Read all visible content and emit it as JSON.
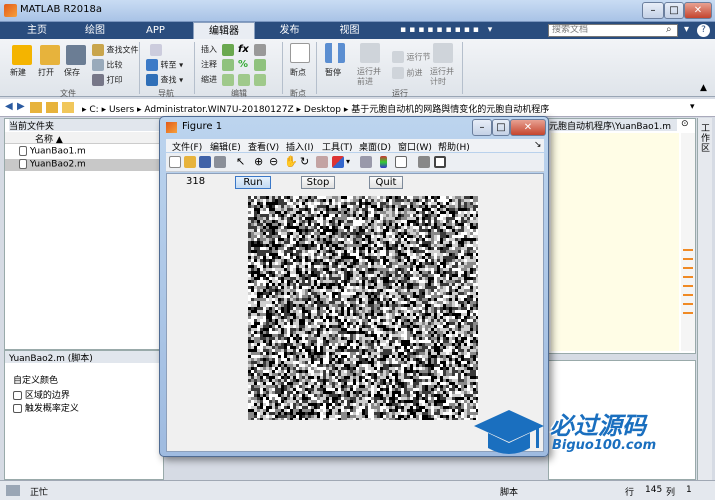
{
  "window": {
    "title": "MATLAB R2018a"
  },
  "tabs": [
    {
      "label": "主页"
    },
    {
      "label": "绘图"
    },
    {
      "label": "APP"
    },
    {
      "label": "编辑器"
    },
    {
      "label": "发布"
    },
    {
      "label": "视图"
    }
  ],
  "search": {
    "placeholder": "搜索文档"
  },
  "ribbon": {
    "new": "新建",
    "open": "打开",
    "save": "保存",
    "find_files": "查找文件",
    "compare": "比较",
    "print": "打印",
    "insert": "插入",
    "comment": "注释",
    "indent": "缩进",
    "goto": "转至",
    "find": "查找",
    "breakpoints": "断点",
    "pause": "暂停",
    "run_advance": "运行并\n前进",
    "run_section": "运行节",
    "advance": "前进",
    "run_time": "运行并\n计时",
    "groups": {
      "file": "文件",
      "nav": "导航",
      "edit": "编辑",
      "bp": "断点",
      "run": "运行"
    }
  },
  "path": {
    "parts": [
      "C:",
      "Users",
      "Administrator.WIN7U-20180127Z",
      "Desktop",
      "基于元胞自动机的网路舆情变化的元胞自动机程序"
    ]
  },
  "current_folder": {
    "title": "当前文件夹",
    "col_name": "名称",
    "files": [
      {
        "name": "YuanBao1.m"
      },
      {
        "name": "YuanBao2.m"
      }
    ]
  },
  "details": {
    "title": "YuanBao2.m  (脚本)",
    "items": [
      "自定义颜色",
      "区域的边界",
      "触发概率定义"
    ]
  },
  "editor": {
    "path_tail": "元胞自动机程序\\YuanBao1.m"
  },
  "figure": {
    "title": "Figure 1",
    "menu": [
      "文件(F)",
      "编辑(E)",
      "查看(V)",
      "插入(I)",
      "工具(T)",
      "桌面(D)",
      "窗口(W)",
      "帮助(H)"
    ],
    "counter": "318",
    "buttons": {
      "run": "Run",
      "stop": "Stop",
      "quit": "Quit"
    }
  },
  "rightbar": {
    "label": "工作区"
  },
  "status": {
    "left": "正忙",
    "mode": "脚本",
    "row_label": "行",
    "row": "145",
    "col_label": "列",
    "col": "1"
  },
  "logo": {
    "text": "必过源码",
    "url": "Biguo100.com"
  },
  "colors": {
    "tabstrip": "#2a4d7e",
    "figure_frame": "#9fbbe0",
    "logo_blue": "#1a6fbf"
  }
}
